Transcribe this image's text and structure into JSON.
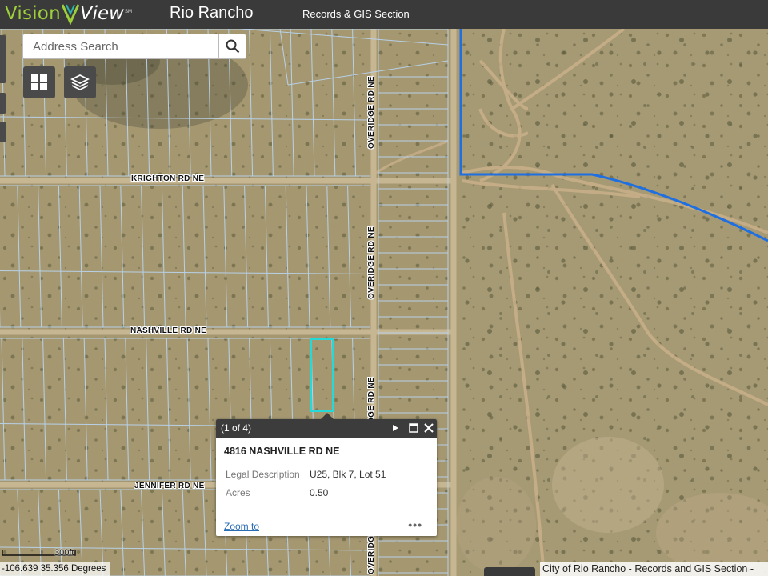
{
  "header": {
    "logo_part1": "Vision",
    "logo_part2": "View",
    "logo_sm": "SM",
    "app_title": "Rio Rancho",
    "section_title": "Records & GIS Section"
  },
  "search": {
    "placeholder": "Address Search"
  },
  "icons": {
    "search": "search-icon",
    "basemap": "grid-icon",
    "layers": "layers-icon",
    "next": "play-icon",
    "maximize": "maximize-icon",
    "close": "close-icon"
  },
  "roads": {
    "krighton": "KRIGHTON RD NE",
    "nashville": "NASHVILLE RD NE",
    "jennifer": "JENNIFER RD NE",
    "overidge": "OVERIDGE RD NE",
    "overidge_partial": "OVERIDGE RD NE",
    "overidge_bottom": "OVERIDGE"
  },
  "popup": {
    "count": "(1 of 4)",
    "title": "4816 NASHVILLE RD NE",
    "fields": [
      {
        "label": "Legal Description",
        "value": "U25, Blk 7, Lot 51"
      },
      {
        "label": "Acres",
        "value": "0.50"
      }
    ],
    "zoom_link": "Zoom to",
    "more": "•••"
  },
  "footer": {
    "coords": "-106.639 35.356 Degrees",
    "scale": "300ft",
    "attribution": "City of Rio Rancho - Records and GIS Section - "
  },
  "colors": {
    "header_bg": "#3a3a3a",
    "logo_green": "#9ccf3a",
    "parcel_line": "#b9d3ee",
    "selected_parcel": "#25d9d9",
    "boundary_line": "#1f6fe0",
    "dirt_road": "#c9b08a"
  }
}
